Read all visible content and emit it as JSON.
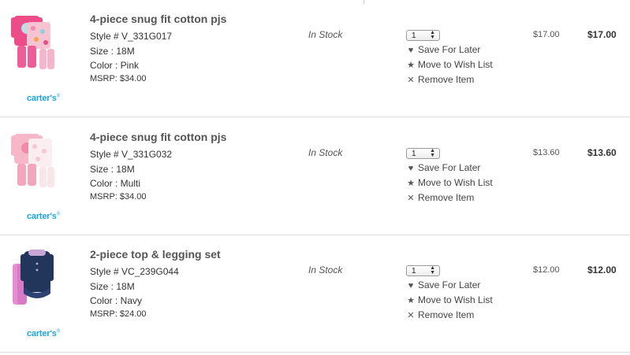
{
  "items": [
    {
      "title": "4-piece snug fit cotton pjs",
      "style": "Style # V_331G017",
      "size": "Size : 18M",
      "color": "Color : Pink",
      "msrp": "MSRP: $34.00",
      "brand": "carter's",
      "brand_tm": "®",
      "stock": "In Stock",
      "qty": "1",
      "save_label": "Save For Later",
      "wish_label": "Move to Wish List",
      "remove_label": "Remove Item",
      "unit_price": "$17.00",
      "total_price": "$17.00",
      "swatch": "#e84a8a"
    },
    {
      "title": "4-piece snug fit cotton pjs",
      "style": "Style # V_331G032",
      "size": "Size : 18M",
      "color": "Color : Multi",
      "msrp": "MSRP: $34.00",
      "brand": "carter's",
      "brand_tm": "®",
      "stock": "In Stock",
      "qty": "1",
      "save_label": "Save For Later",
      "wish_label": "Move to Wish List",
      "remove_label": "Remove Item",
      "unit_price": "$13.60",
      "total_price": "$13.60",
      "swatch": "#f3b2c3"
    },
    {
      "title": "2-piece top & legging set",
      "style": "Style # VC_239G044",
      "size": "Size : 18M",
      "color": "Color : Navy",
      "msrp": "MSRP: $24.00",
      "brand": "carter's",
      "brand_tm": "®",
      "stock": "In Stock",
      "qty": "1",
      "save_label": "Save For Later",
      "wish_label": "Move to Wish List",
      "remove_label": "Remove Item",
      "unit_price": "$12.00",
      "total_price": "$12.00",
      "swatch": "#23365c"
    }
  ],
  "icons": {
    "save": "heart-icon",
    "wish": "star-icon",
    "remove": "close-icon",
    "qty": "updown-arrows-icon"
  },
  "colors": {
    "brand_blue": "#1ea3dc",
    "divider": "#dcdcdc"
  }
}
